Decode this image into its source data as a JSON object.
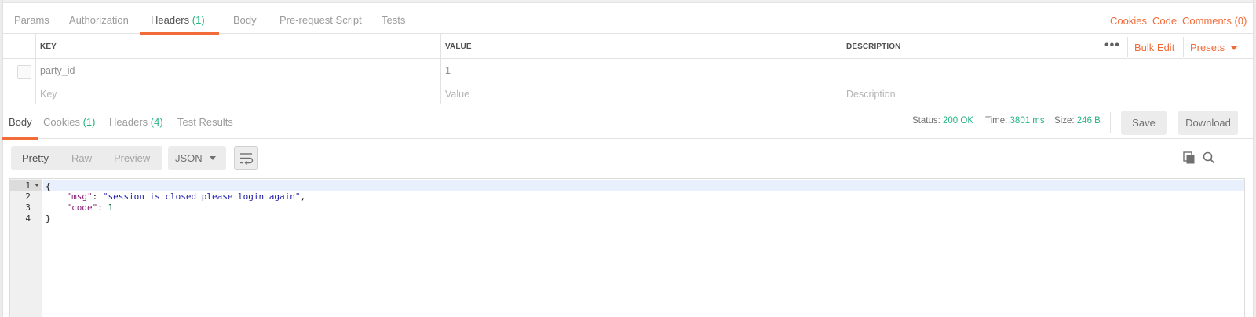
{
  "request_tabs": [
    {
      "label": "Params",
      "count": ""
    },
    {
      "label": "Authorization",
      "count": ""
    },
    {
      "label": "Headers",
      "count": "(1)"
    },
    {
      "label": "Body",
      "count": ""
    },
    {
      "label": "Pre-request Script",
      "count": ""
    },
    {
      "label": "Tests",
      "count": ""
    }
  ],
  "request_links": {
    "cookies": "Cookies",
    "code": "Code",
    "comments": "Comments (0)"
  },
  "headers_table": {
    "columns": {
      "key": "KEY",
      "value": "VALUE",
      "description": "DESCRIPTION"
    },
    "more": "•••",
    "bulk_edit": "Bulk Edit",
    "presets": "Presets",
    "rows": [
      {
        "key": "party_id",
        "value": "1",
        "description": ""
      }
    ],
    "placeholders": {
      "key": "Key",
      "value": "Value",
      "description": "Description"
    }
  },
  "response_tabs": [
    {
      "label": "Body",
      "count": ""
    },
    {
      "label": "Cookies",
      "count": "(1)"
    },
    {
      "label": "Headers",
      "count": "(4)"
    },
    {
      "label": "Test Results",
      "count": ""
    }
  ],
  "response_status": {
    "status_label": "Status:",
    "status_value": "200 OK",
    "time_label": "Time:",
    "time_value": "3801 ms",
    "size_label": "Size:",
    "size_value": "246 B"
  },
  "response_actions": {
    "save": "Save",
    "download": "Download"
  },
  "view_modes": [
    "Pretty",
    "Raw",
    "Preview"
  ],
  "format": "JSON",
  "code": {
    "line_numbers": [
      "1",
      "2",
      "3",
      "4"
    ],
    "open_brace": "{",
    "close_brace": "}",
    "msg_key": "\"msg\"",
    "msg_value": "\"session is closed please login again\"",
    "code_key": "\"code\"",
    "code_value": "1"
  },
  "colors": {
    "accent": "#f26b3a",
    "success": "#26b47f"
  }
}
